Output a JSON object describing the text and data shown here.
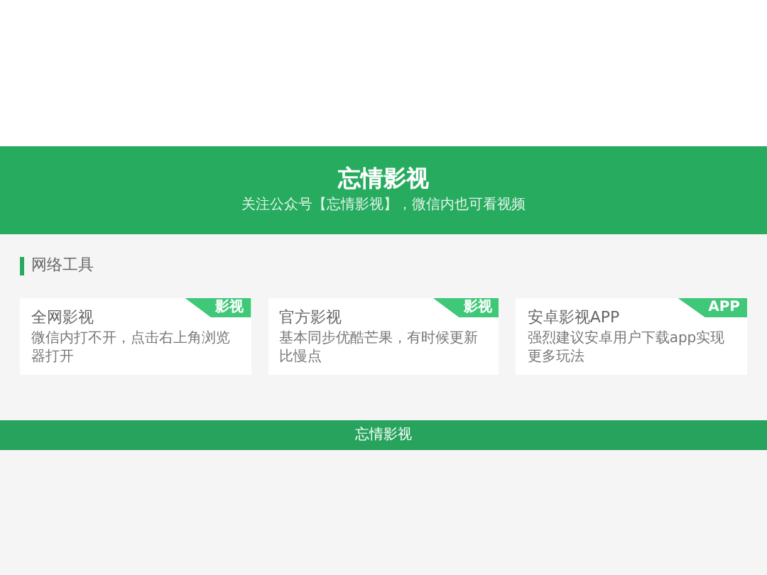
{
  "header": {
    "title": "忘情影视",
    "subtitle": "关注公众号【忘情影视】，微信内也可看视频"
  },
  "section": {
    "title": "网络工具"
  },
  "cards": [
    {
      "title": "全网影视",
      "description": "微信内打不开，点击右上角浏览器打开",
      "tag": "影视"
    },
    {
      "title": "官方影视",
      "description": "基本同步优酷芒果，有时候更新比慢点",
      "tag": "影视"
    },
    {
      "title": "安卓影视APP",
      "description": "强烈建议安卓用户下载app实现更多玩法",
      "tag": "APP"
    }
  ],
  "footer": {
    "text": "忘情影视"
  }
}
